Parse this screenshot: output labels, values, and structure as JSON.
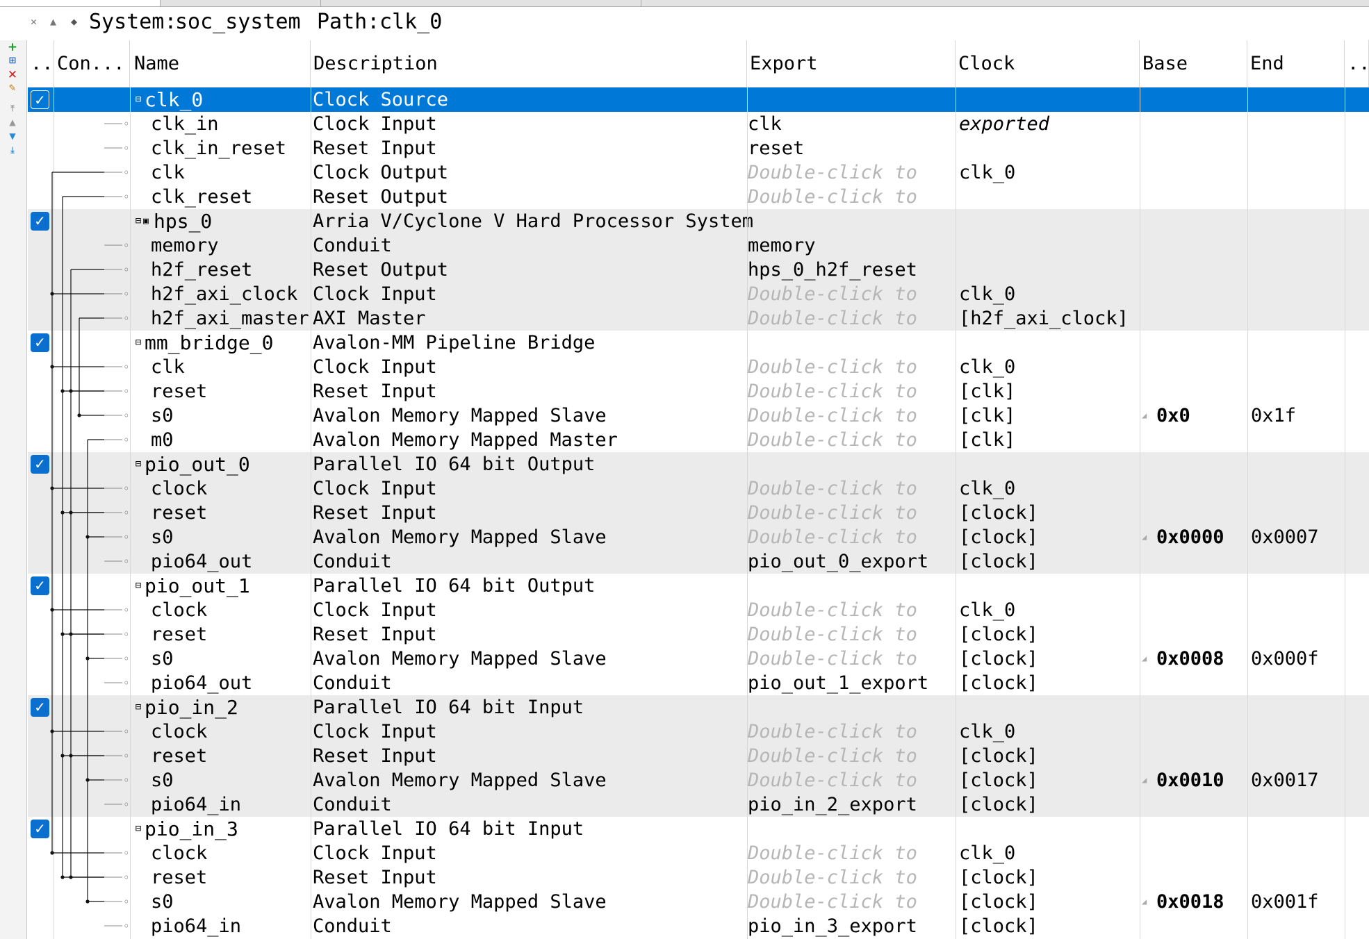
{
  "path_bar": {
    "system_label": "System:",
    "system_value": "soc_system",
    "path_label": "Path:",
    "path_value": "clk_0"
  },
  "columns": [
    "..",
    "Con...",
    "Name",
    "Description",
    "Export",
    "Clock",
    "Base",
    "End",
    ".."
  ],
  "export_placeholder": "Double-click to",
  "rows": [
    {
      "kind": "component",
      "name": "clk_0",
      "description": "Clock Source",
      "export": "",
      "clock": "",
      "base": "",
      "end": "",
      "selected": true,
      "enabled": true
    },
    {
      "kind": "interface",
      "name": "clk_in",
      "description": "Clock Input",
      "export": "clk",
      "clock": "exported",
      "clock_italic": true
    },
    {
      "kind": "interface",
      "name": "clk_in_reset",
      "description": "Reset Input",
      "export": "reset",
      "clock": ""
    },
    {
      "kind": "interface",
      "name": "clk",
      "description": "Clock Output",
      "export": "Double-click to",
      "export_placeholder": true,
      "clock": "clk_0"
    },
    {
      "kind": "interface",
      "name": "clk_reset",
      "description": "Reset Output",
      "export": "Double-click to",
      "export_placeholder": true,
      "clock": ""
    },
    {
      "kind": "component",
      "name": "hps_0",
      "description": "Arria V/Cyclone V Hard Processor System",
      "enabled": true,
      "has_icon": true
    },
    {
      "kind": "interface",
      "name": "memory",
      "description": "Conduit",
      "export": "memory",
      "clock": ""
    },
    {
      "kind": "interface",
      "name": "h2f_reset",
      "description": "Reset Output",
      "export": "hps_0_h2f_reset",
      "clock": ""
    },
    {
      "kind": "interface",
      "name": "h2f_axi_clock",
      "description": "Clock Input",
      "export": "Double-click to",
      "export_placeholder": true,
      "clock": "clk_0"
    },
    {
      "kind": "interface",
      "name": "h2f_axi_master",
      "description": "AXI Master",
      "export": "Double-click to",
      "export_placeholder": true,
      "clock": "[h2f_axi_clock]"
    },
    {
      "kind": "component",
      "name": "mm_bridge_0",
      "description": "Avalon-MM Pipeline Bridge",
      "enabled": true
    },
    {
      "kind": "interface",
      "name": "clk",
      "description": "Clock Input",
      "export": "Double-click to",
      "export_placeholder": true,
      "clock": "clk_0"
    },
    {
      "kind": "interface",
      "name": "reset",
      "description": "Reset Input",
      "export": "Double-click to",
      "export_placeholder": true,
      "clock": "[clk]"
    },
    {
      "kind": "interface",
      "name": "s0",
      "description": "Avalon Memory Mapped Slave",
      "export": "Double-click to",
      "export_placeholder": true,
      "clock": "[clk]",
      "base": "0x0",
      "end": "0x1f"
    },
    {
      "kind": "interface",
      "name": "m0",
      "description": "Avalon Memory Mapped Master",
      "export": "Double-click to",
      "export_placeholder": true,
      "clock": "[clk]"
    },
    {
      "kind": "component",
      "name": "pio_out_0",
      "description": "Parallel IO 64 bit Output",
      "enabled": true
    },
    {
      "kind": "interface",
      "name": "clock",
      "description": "Clock Input",
      "export": "Double-click to",
      "export_placeholder": true,
      "clock": "clk_0"
    },
    {
      "kind": "interface",
      "name": "reset",
      "description": "Reset Input",
      "export": "Double-click to",
      "export_placeholder": true,
      "clock": "[clock]"
    },
    {
      "kind": "interface",
      "name": "s0",
      "description": "Avalon Memory Mapped Slave",
      "export": "Double-click to",
      "export_placeholder": true,
      "clock": "[clock]",
      "base": "0x0000",
      "end": "0x0007"
    },
    {
      "kind": "interface",
      "name": "pio64_out",
      "description": "Conduit",
      "export": "pio_out_0_export",
      "clock": "[clock]"
    },
    {
      "kind": "component",
      "name": "pio_out_1",
      "description": "Parallel IO 64 bit Output",
      "enabled": true
    },
    {
      "kind": "interface",
      "name": "clock",
      "description": "Clock Input",
      "export": "Double-click to",
      "export_placeholder": true,
      "clock": "clk_0"
    },
    {
      "kind": "interface",
      "name": "reset",
      "description": "Reset Input",
      "export": "Double-click to",
      "export_placeholder": true,
      "clock": "[clock]"
    },
    {
      "kind": "interface",
      "name": "s0",
      "description": "Avalon Memory Mapped Slave",
      "export": "Double-click to",
      "export_placeholder": true,
      "clock": "[clock]",
      "base": "0x0008",
      "end": "0x000f"
    },
    {
      "kind": "interface",
      "name": "pio64_out",
      "description": "Conduit",
      "export": "pio_out_1_export",
      "clock": "[clock]"
    },
    {
      "kind": "component",
      "name": "pio_in_2",
      "description": "Parallel IO 64 bit Input",
      "enabled": true
    },
    {
      "kind": "interface",
      "name": "clock",
      "description": "Clock Input",
      "export": "Double-click to",
      "export_placeholder": true,
      "clock": "clk_0"
    },
    {
      "kind": "interface",
      "name": "reset",
      "description": "Reset Input",
      "export": "Double-click to",
      "export_placeholder": true,
      "clock": "[clock]"
    },
    {
      "kind": "interface",
      "name": "s0",
      "description": "Avalon Memory Mapped Slave",
      "export": "Double-click to",
      "export_placeholder": true,
      "clock": "[clock]",
      "base": "0x0010",
      "end": "0x0017"
    },
    {
      "kind": "interface",
      "name": "pio64_in",
      "description": "Conduit",
      "export": "pio_in_2_export",
      "clock": "[clock]"
    },
    {
      "kind": "component",
      "name": "pio_in_3",
      "description": "Parallel IO 64 bit Input",
      "enabled": true
    },
    {
      "kind": "interface",
      "name": "clock",
      "description": "Clock Input",
      "export": "Double-click to",
      "export_placeholder": true,
      "clock": "clk_0"
    },
    {
      "kind": "interface",
      "name": "reset",
      "description": "Reset Input",
      "export": "Double-click to",
      "export_placeholder": true,
      "clock": "[clock]"
    },
    {
      "kind": "interface",
      "name": "s0",
      "description": "Avalon Memory Mapped Slave",
      "export": "Double-click to",
      "export_placeholder": true,
      "clock": "[clock]",
      "base": "0x0018",
      "end": "0x001f"
    },
    {
      "kind": "interface",
      "name": "pio64_in",
      "description": "Conduit",
      "export": "pio_in_3_export",
      "clock": "[clock]"
    }
  ],
  "colors": {
    "selection": "#0078d7",
    "checkbox": "#0b6fcf",
    "group_band": "#ebebeb",
    "placeholder_text": "#b6b6b6"
  },
  "toolbar_icons": [
    "add-icon",
    "add-connection-icon",
    "remove-icon",
    "edit-icon",
    "move-top-icon",
    "move-up-icon",
    "move-down-icon",
    "move-bottom-icon"
  ]
}
